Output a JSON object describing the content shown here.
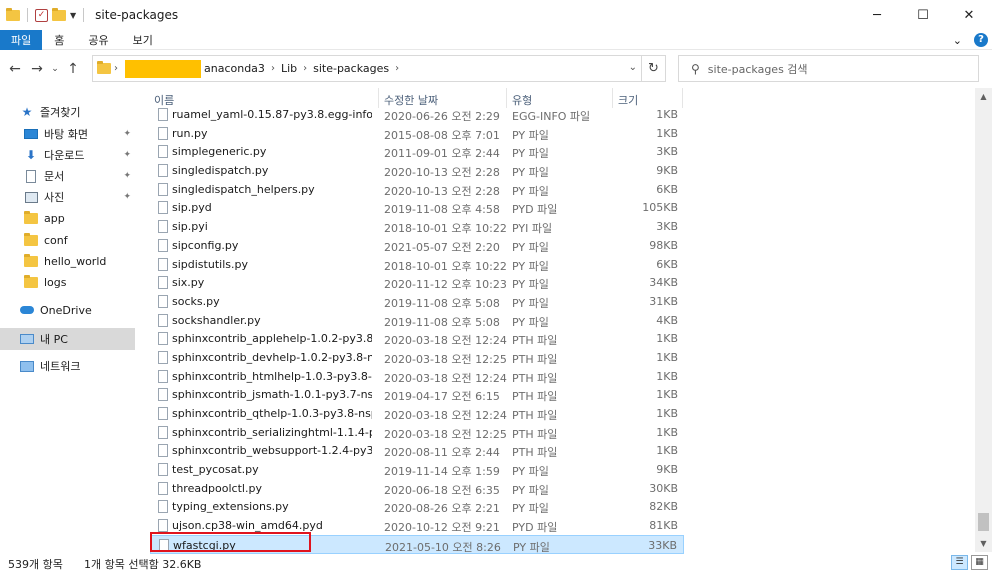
{
  "window": {
    "title": "site-packages",
    "minimize": "─",
    "maximize": "☐",
    "close": "✕"
  },
  "ribbon": {
    "tabs": [
      "파일",
      "홈",
      "공유",
      "보기"
    ],
    "expand": "⌄",
    "help": "?"
  },
  "address": {
    "path": [
      "anaconda3",
      "Lib",
      "site-packages"
    ]
  },
  "search": {
    "placeholder": "site-packages 검색"
  },
  "sidebar": {
    "quick_access": "즐겨찾기",
    "items": [
      {
        "label": "바탕 화면",
        "icon": "desktop-icon",
        "pinned": true
      },
      {
        "label": "다운로드",
        "icon": "download-icon",
        "pinned": true
      },
      {
        "label": "문서",
        "icon": "document-icon",
        "pinned": true
      },
      {
        "label": "사진",
        "icon": "pictures-icon",
        "pinned": true
      },
      {
        "label": "app",
        "icon": "folder-icon",
        "pinned": false
      },
      {
        "label": "conf",
        "icon": "folder-icon",
        "pinned": false
      },
      {
        "label": "hello_world",
        "icon": "folder-icon",
        "pinned": false
      },
      {
        "label": "logs",
        "icon": "folder-icon",
        "pinned": false
      }
    ],
    "onedrive": "OneDrive",
    "this_pc": "내 PC",
    "network": "네트워크"
  },
  "columns": {
    "name": "이름",
    "date": "수정한 날짜",
    "type": "유형",
    "size": "크기"
  },
  "files": [
    {
      "name": "ruamel_yaml-0.15.87-py3.8.egg-info",
      "date": "2020-06-26 오전 2:29",
      "type": "EGG-INFO 파일",
      "size": "1KB"
    },
    {
      "name": "run.py",
      "date": "2015-08-08 오후 7:01",
      "type": "PY 파일",
      "size": "1KB"
    },
    {
      "name": "simplegeneric.py",
      "date": "2011-09-01 오후 2:44",
      "type": "PY 파일",
      "size": "3KB"
    },
    {
      "name": "singledispatch.py",
      "date": "2020-10-13 오전 2:28",
      "type": "PY 파일",
      "size": "9KB"
    },
    {
      "name": "singledispatch_helpers.py",
      "date": "2020-10-13 오전 2:28",
      "type": "PY 파일",
      "size": "6KB"
    },
    {
      "name": "sip.pyd",
      "date": "2019-11-08 오후 4:58",
      "type": "PYD 파일",
      "size": "105KB"
    },
    {
      "name": "sip.pyi",
      "date": "2018-10-01 오후 10:22",
      "type": "PYI 파일",
      "size": "3KB"
    },
    {
      "name": "sipconfig.py",
      "date": "2021-05-07 오전 2:20",
      "type": "PY 파일",
      "size": "98KB"
    },
    {
      "name": "sipdistutils.py",
      "date": "2018-10-01 오후 10:22",
      "type": "PY 파일",
      "size": "6KB"
    },
    {
      "name": "six.py",
      "date": "2020-11-12 오후 10:23",
      "type": "PY 파일",
      "size": "34KB"
    },
    {
      "name": "socks.py",
      "date": "2019-11-08 오후 5:08",
      "type": "PY 파일",
      "size": "31KB"
    },
    {
      "name": "sockshandler.py",
      "date": "2019-11-08 오후 5:08",
      "type": "PY 파일",
      "size": "4KB"
    },
    {
      "name": "sphinxcontrib_applehelp-1.0.2-py3.8-ns...",
      "date": "2020-03-18 오전 12:24",
      "type": "PTH 파일",
      "size": "1KB"
    },
    {
      "name": "sphinxcontrib_devhelp-1.0.2-py3.8-nspk...",
      "date": "2020-03-18 오전 12:25",
      "type": "PTH 파일",
      "size": "1KB"
    },
    {
      "name": "sphinxcontrib_htmlhelp-1.0.3-py3.8-nsp...",
      "date": "2020-03-18 오전 12:24",
      "type": "PTH 파일",
      "size": "1KB"
    },
    {
      "name": "sphinxcontrib_jsmath-1.0.1-py3.7-nspk...",
      "date": "2019-04-17 오전 6:15",
      "type": "PTH 파일",
      "size": "1KB"
    },
    {
      "name": "sphinxcontrib_qthelp-1.0.3-py3.8-nspkg...",
      "date": "2020-03-18 오전 12:24",
      "type": "PTH 파일",
      "size": "1KB"
    },
    {
      "name": "sphinxcontrib_serializinghtml-1.1.4-py3....",
      "date": "2020-03-18 오전 12:25",
      "type": "PTH 파일",
      "size": "1KB"
    },
    {
      "name": "sphinxcontrib_websupport-1.2.4-py3.7-...",
      "date": "2020-08-11 오후 2:44",
      "type": "PTH 파일",
      "size": "1KB"
    },
    {
      "name": "test_pycosat.py",
      "date": "2019-11-14 오후 1:59",
      "type": "PY 파일",
      "size": "9KB"
    },
    {
      "name": "threadpoolctl.py",
      "date": "2020-06-18 오전 6:35",
      "type": "PY 파일",
      "size": "30KB"
    },
    {
      "name": "typing_extensions.py",
      "date": "2020-08-26 오후 2:21",
      "type": "PY 파일",
      "size": "82KB"
    },
    {
      "name": "ujson.cp38-win_amd64.pyd",
      "date": "2020-10-12 오전 9:21",
      "type": "PYD 파일",
      "size": "81KB"
    },
    {
      "name": "wfastcgi.py",
      "date": "2021-05-10 오전 8:26",
      "type": "PY 파일",
      "size": "33KB",
      "selected": true
    }
  ],
  "status": {
    "count": "539개 항목",
    "selection": "1개 항목 선택함 32.6KB"
  },
  "colors": {
    "accent": "#1979ca",
    "selection": "#cce8ff",
    "highlight_box": "#e0141e",
    "redaction": "#ffc000"
  }
}
